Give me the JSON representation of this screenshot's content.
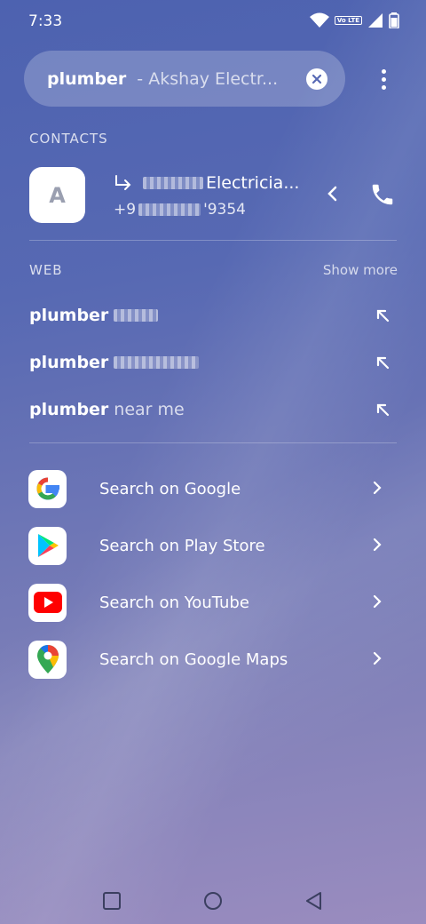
{
  "status": {
    "time": "7:33",
    "volte_label": "Vo LTE"
  },
  "search": {
    "query": "plumber",
    "suggestion": "- Akshay Electr..."
  },
  "contacts": {
    "section_label": "CONTACTS",
    "avatar_letter": "A",
    "name_suffix": "Electricia...",
    "number_prefix": "+9",
    "number_suffix": "'9354"
  },
  "web": {
    "section_label": "WEB",
    "show_more": "Show more",
    "items": [
      {
        "query": "plumber",
        "rest": ""
      },
      {
        "query": "plumber",
        "rest": ""
      },
      {
        "query": "plumber",
        "rest": "near me"
      }
    ]
  },
  "search_on": [
    {
      "label": "Search on Google",
      "icon": "google-icon"
    },
    {
      "label": "Search on Play Store",
      "icon": "play-store-icon"
    },
    {
      "label": "Search on YouTube",
      "icon": "youtube-icon"
    },
    {
      "label": "Search on Google Maps",
      "icon": "google-maps-icon"
    }
  ],
  "colors": {
    "background_top": "#4d62b0",
    "background_bottom": "#9a8cbf"
  }
}
